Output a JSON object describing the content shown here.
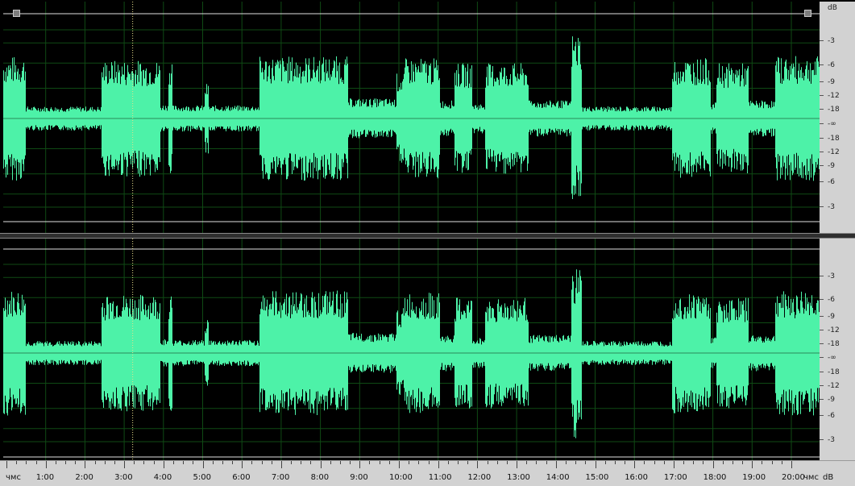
{
  "colors": {
    "background": "#000000",
    "waveform": "#4df2a8",
    "grid": "#0f4a14",
    "playhead": "#e8e08a",
    "ruler": "#d2d2d2"
  },
  "icons": {
    "loop_start": "square-handle-icon",
    "loop_end": "square-handle-icon"
  },
  "db_scale": {
    "unit_label": "dB",
    "top_labels": [
      "-3",
      "-6",
      "-9",
      "-12",
      "-18",
      "-∞",
      "-18",
      "-12",
      "-9",
      "-6",
      "-3"
    ],
    "bottom_labels": [
      "-3",
      "-6",
      "-9",
      "-12",
      "-18",
      "-∞",
      "-18",
      "-12",
      "-9",
      "-6",
      "-3"
    ],
    "bottom_unit_label": "dB"
  },
  "time_ruler": {
    "start_label": "чмс",
    "end_label": "чмс",
    "labels": [
      "1:00",
      "2:00",
      "3:00",
      "4:00",
      "5:00",
      "6:00",
      "7:00",
      "8:00",
      "9:00",
      "10:00",
      "11:00",
      "12:00",
      "13:00",
      "14:00",
      "15:00",
      "16:00",
      "17:00",
      "18:00",
      "19:00",
      "20:00"
    ]
  },
  "playhead_time": "3:13"
}
